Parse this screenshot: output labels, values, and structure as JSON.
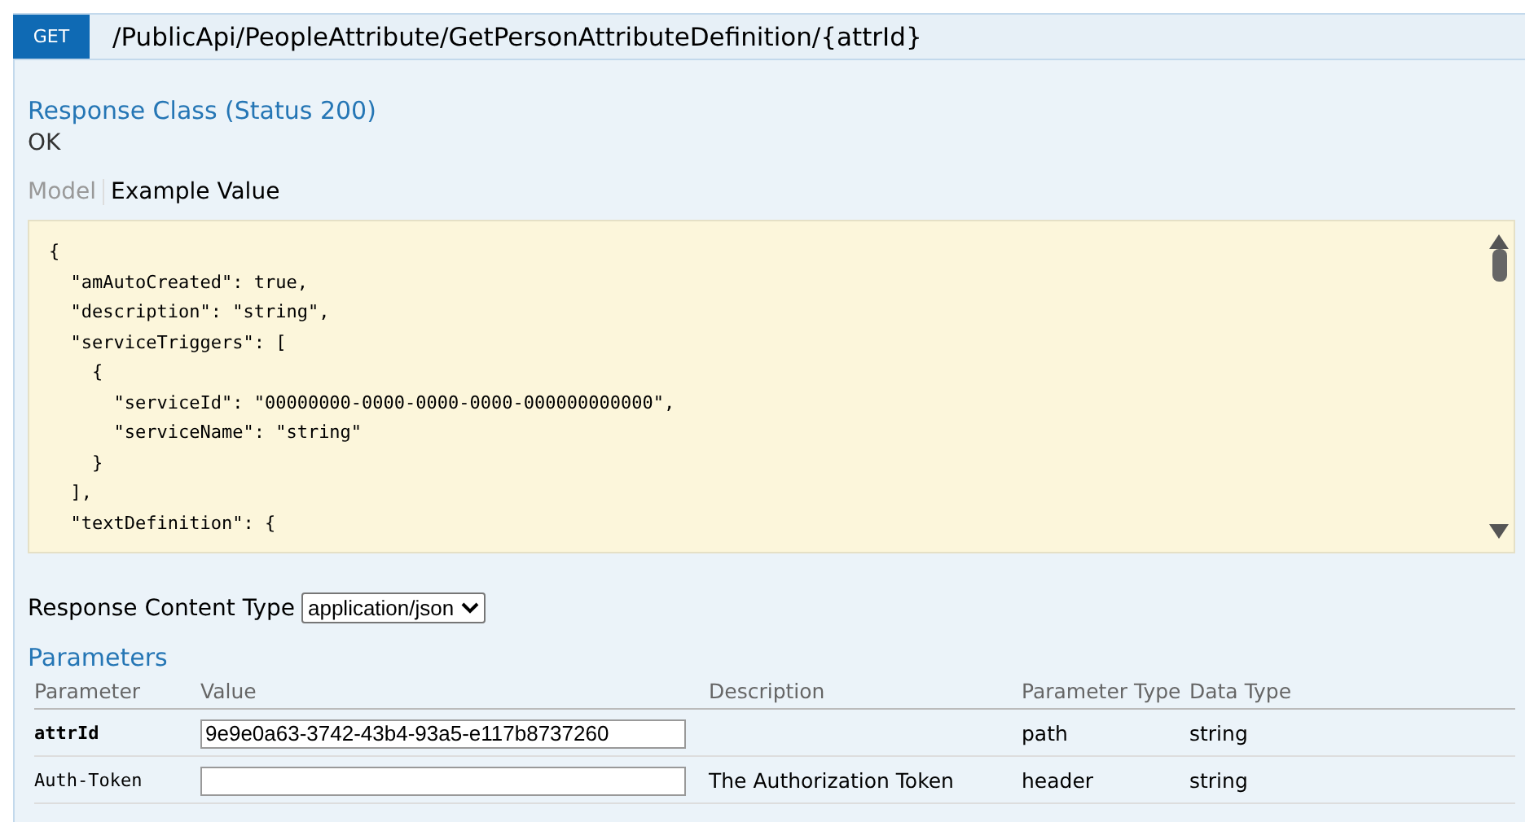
{
  "endpoint": {
    "method": "GET",
    "path": "/PublicApi/PeopleAttribute/GetPersonAttributeDefinition/{attrId}"
  },
  "response_class": {
    "title": "Response Class (Status 200)",
    "status_text": "OK"
  },
  "tabs": [
    {
      "label": "Model",
      "selected": false
    },
    {
      "label": "Example Value",
      "selected": true
    }
  ],
  "example_lines": [
    "{",
    "  \"amAutoCreated\": true,",
    "  \"description\": \"string\",",
    "  \"serviceTriggers\": [",
    "    {",
    "      \"serviceId\": \"00000000-0000-0000-0000-000000000000\",",
    "      \"serviceName\": \"string\"",
    "    }",
    "  ],",
    "  \"textDefinition\": {"
  ],
  "content_type": {
    "label": "Response Content Type",
    "value": "application/json"
  },
  "parameters": {
    "title": "Parameters",
    "columns": [
      "Parameter",
      "Value",
      "Description",
      "Parameter Type",
      "Data Type"
    ],
    "rows": [
      {
        "name": "attrId",
        "required": true,
        "value": "9e9e0a63-3742-43b4-93a5-e117b8737260",
        "description": "",
        "param_type": "path",
        "data_type": "string"
      },
      {
        "name": "Auth-Token",
        "required": false,
        "value": "",
        "description": "The Authorization Token",
        "param_type": "header",
        "data_type": "string"
      }
    ]
  }
}
